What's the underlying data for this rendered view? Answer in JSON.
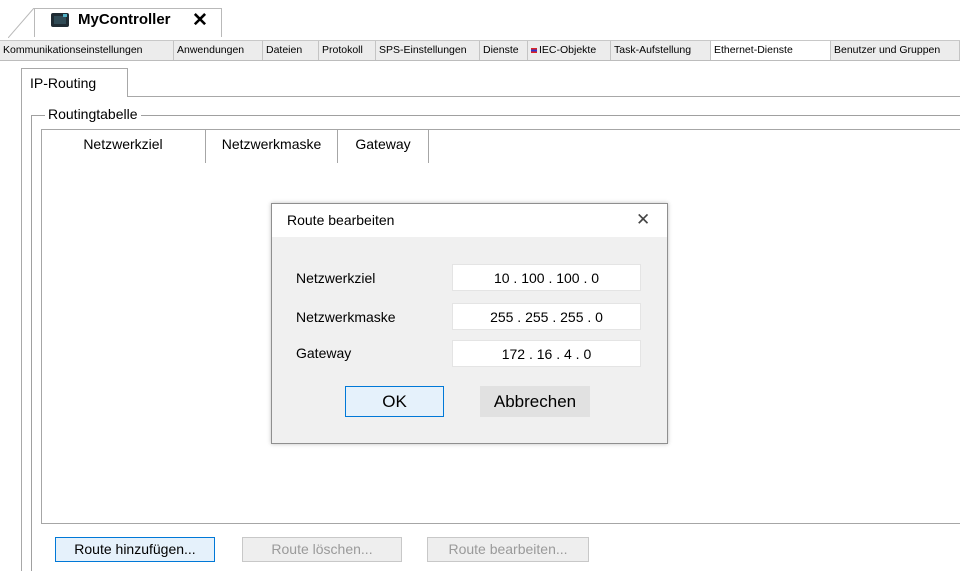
{
  "document": {
    "title": "MyController",
    "close_glyph": "✕"
  },
  "category_tabs": [
    {
      "label": "Kommunikationseinstellungen"
    },
    {
      "label": "Anwendungen"
    },
    {
      "label": "Dateien"
    },
    {
      "label": "Protokoll"
    },
    {
      "label": "SPS-Einstellungen"
    },
    {
      "label": "Dienste"
    },
    {
      "label": "IEC-Objekte"
    },
    {
      "label": "Task-Aufstellung"
    },
    {
      "label": "Ethernet-Dienste",
      "active": true
    },
    {
      "label": "Benutzer und Gruppen"
    }
  ],
  "sub_tab": {
    "label": "IP-Routing"
  },
  "group": {
    "label": "Routingtabelle"
  },
  "table": {
    "columns": [
      "Netzwerkziel",
      "Netzwerkmaske",
      "Gateway"
    ]
  },
  "dialog": {
    "title": "Route bearbeiten",
    "close_glyph": "✕",
    "fields": [
      {
        "label": "Netzwerkziel",
        "value": "10 . 100 . 100 . 0"
      },
      {
        "label": "Netzwerkmaske",
        "value": "255 . 255 . 255 . 0"
      },
      {
        "label": "Gateway",
        "value": "172 . 16 . 4 . 0"
      }
    ],
    "ok_label": "OK",
    "cancel_label": "Abbrechen"
  },
  "buttons": {
    "add": "Route hinzufügen...",
    "delete": "Route löschen...",
    "edit": "Route bearbeiten..."
  },
  "colors": {
    "accent": "#0078d7",
    "button_focus_bg": "#e5f1fb"
  },
  "icons": {
    "device": "controller-icon",
    "close": "close-icon"
  }
}
